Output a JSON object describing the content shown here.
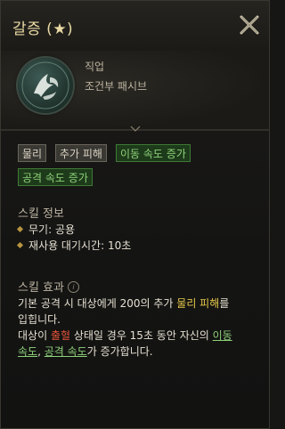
{
  "window": {
    "title": "갈증 (★)"
  },
  "skill": {
    "job_label": "직업",
    "type_label": "조건부 패시브"
  },
  "tags": [
    {
      "label": "물리",
      "style": "gray"
    },
    {
      "label": "추가 피해",
      "style": "gray"
    },
    {
      "label": "이동 속도 증가",
      "style": "green"
    },
    {
      "label": "공격 속도 증가",
      "style": "green"
    }
  ],
  "skill_info": {
    "title": "스킬 정보",
    "weapon": "무기: 공용",
    "cooldown": "재사용 대기시간: 10초"
  },
  "skill_effect": {
    "title": "스킬 효과",
    "line1_a": "기본 공격 시 대상에게 200의 추가 ",
    "line1_highlight": "물리 피해",
    "line1_b": "를",
    "line2": "입힙니다.",
    "line3_a": "대상이 ",
    "line3_red": "출혈",
    "line3_b": " 상태일 경우 15초 동안 자신의 ",
    "line3_green1": "이동",
    "line4_green1": "속도",
    "line4_sep": ", ",
    "line4_green2": "공격 속도",
    "line4_tail": "가 증가합니다."
  },
  "colors": {
    "accent_gold": "#e9d9a4",
    "highlight_yellow": "#e6c84a",
    "bleed_red": "#e0533a",
    "buff_green": "#8fd27a"
  }
}
